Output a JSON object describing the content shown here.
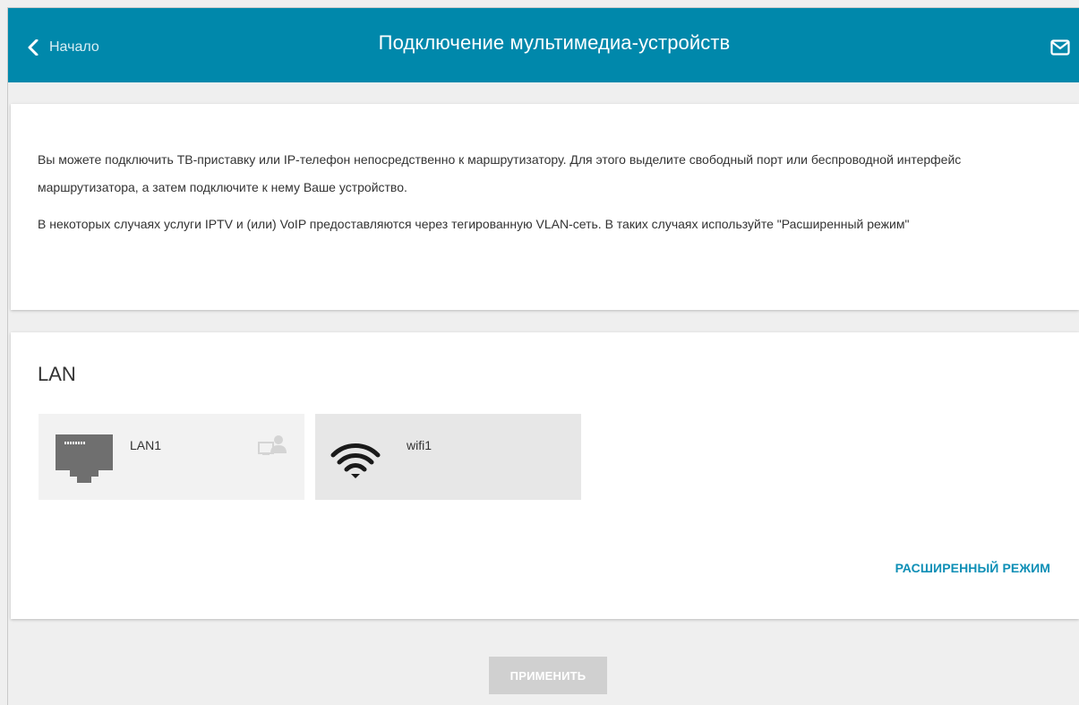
{
  "header": {
    "back_label": "Начало",
    "title": "Подключение мультимедиа-устройств",
    "back_icon": "chevron-left-icon",
    "mail_icon": "envelope-icon",
    "background_color": "#0088ab"
  },
  "intro": {
    "paragraph_1": "Вы можете подключить ТВ-приставку или IP-телефон непосредственно к маршрутизатору. Для этого выделите свободный порт или беспроводной интерфейс маршрутизатора, а затем подключите к нему Ваше устройство.",
    "paragraph_2": "В некоторых случаях услуги IPTV и (или) VoIP предоставляются через тегированную VLAN-сеть. В таких случаях используйте \"Расширенный режим\""
  },
  "lan": {
    "title": "LAN",
    "tiles": [
      {
        "label": "LAN1",
        "icon": "ethernet-port-icon",
        "extra_icon": "user-port-icon"
      },
      {
        "label": "wifi1",
        "icon": "wifi-icon"
      }
    ],
    "advanced_label": "РАСШИРЕННЫЙ РЕЖИМ"
  },
  "footer": {
    "apply_label": "ПРИМЕНИТЬ"
  },
  "colors": {
    "accent": "#0088ab",
    "link": "#0e8fb6",
    "button_disabled": "#d0d0d0"
  }
}
